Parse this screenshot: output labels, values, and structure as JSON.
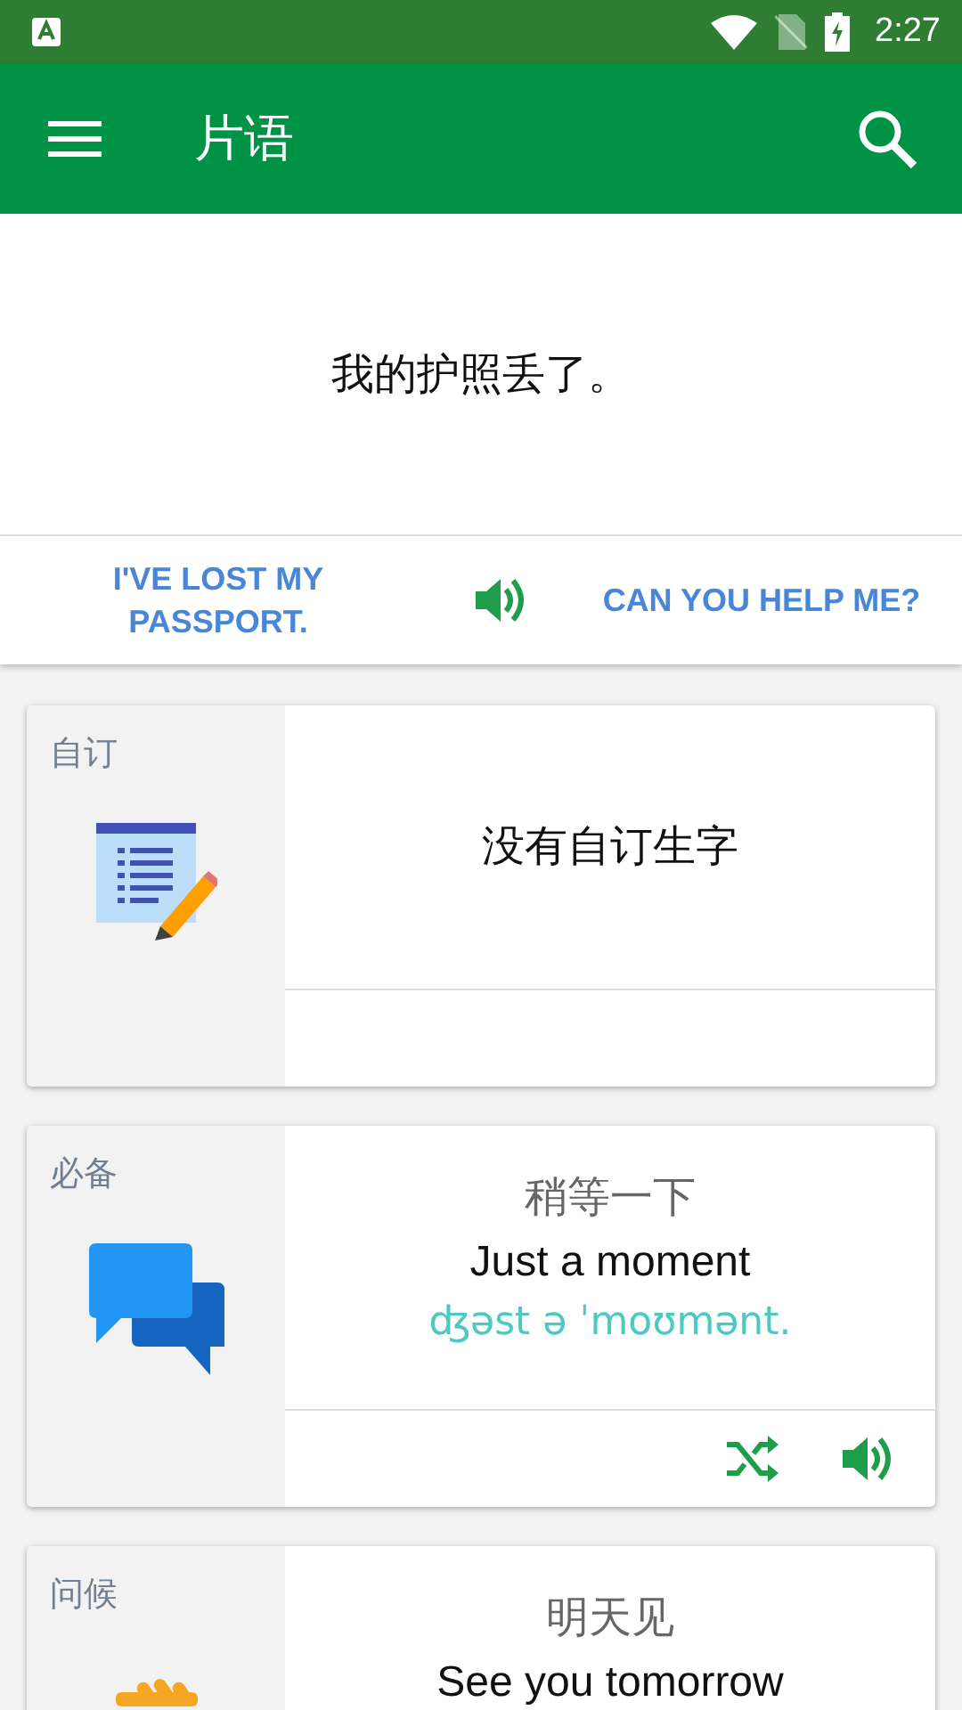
{
  "status_bar": {
    "time": "2:27"
  },
  "app_bar": {
    "title": "片语"
  },
  "hero": {
    "phrase": "我的护照丢了。",
    "left_link": "I'VE LOST MY PASSPORT.",
    "right_link": "CAN YOU HELP ME?"
  },
  "cards": [
    {
      "kind": "empty",
      "category": "自订",
      "message": "没有自订生字"
    },
    {
      "kind": "phrase",
      "category": "必备",
      "chinese": "稍等一下",
      "english": "Just a moment",
      "phonetic": "ʤəst ə ˈmoʊmənt."
    },
    {
      "kind": "phrase",
      "category": "问候",
      "chinese": "明天见",
      "english": "See you tomorrow"
    }
  ]
}
